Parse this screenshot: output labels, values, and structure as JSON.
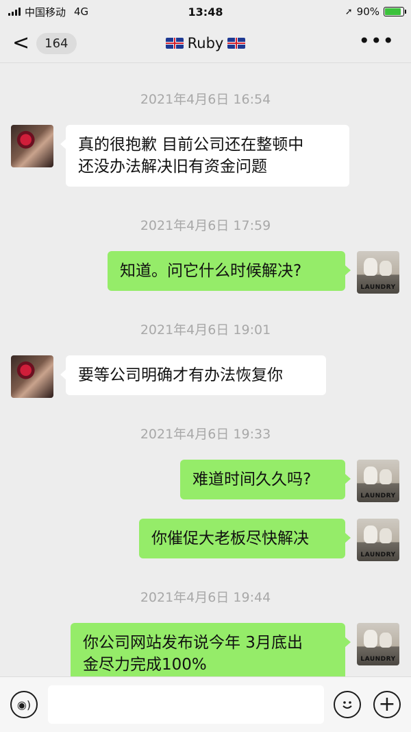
{
  "status_bar": {
    "carrier": "中国移动",
    "network": "4G",
    "time": "13:48",
    "battery": "90%"
  },
  "nav": {
    "unread_count": "164",
    "title": "Ruby"
  },
  "messages": [
    {
      "type": "timestamp",
      "text": "2021年4月6日 16:54"
    },
    {
      "type": "message",
      "side": "left",
      "text": "真的很抱歉 目前公司还在整顿中\n还没办法解决旧有资金问题"
    },
    {
      "type": "timestamp",
      "text": "2021年4月6日 17:59"
    },
    {
      "type": "message",
      "side": "right",
      "text": "知道。问它什么时候解决?"
    },
    {
      "type": "timestamp",
      "text": "2021年4月6日 19:01"
    },
    {
      "type": "message",
      "side": "left",
      "text": "要等公司明确才有办法恢复你"
    },
    {
      "type": "timestamp",
      "text": "2021年4月6日 19:33"
    },
    {
      "type": "message",
      "side": "right",
      "text": "难道时间久久吗?"
    },
    {
      "type": "message",
      "side": "right",
      "text": "你催促大老板尽快解决"
    },
    {
      "type": "timestamp",
      "text": "2021年4月6日 19:44"
    },
    {
      "type": "message",
      "side": "right",
      "text": "你公司网站发布说今年 3月底出\n金尽力完成100%"
    }
  ],
  "avatar_caption": "LAUNDRY",
  "input": {
    "value": "",
    "placeholder": ""
  },
  "colors": {
    "background": "#ededed",
    "outgoing_bubble": "#95ec69",
    "incoming_bubble": "#ffffff",
    "timestamp": "#a8a8a8"
  }
}
